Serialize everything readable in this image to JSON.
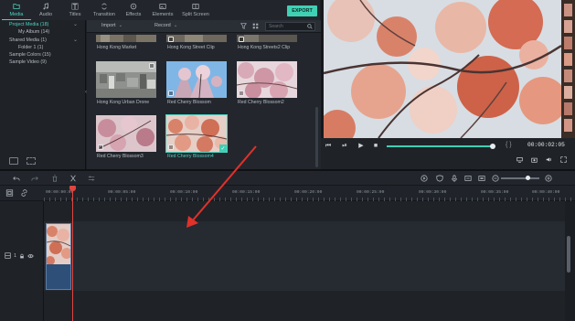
{
  "toolbar": {
    "tabs": [
      {
        "label": "Media",
        "icon": "folder-icon"
      },
      {
        "label": "Audio",
        "icon": "music-note-icon"
      },
      {
        "label": "Titles",
        "icon": "text-icon"
      },
      {
        "label": "Transition",
        "icon": "transition-icon"
      },
      {
        "label": "Effects",
        "icon": "effects-icon"
      },
      {
        "label": "Elements",
        "icon": "elements-icon"
      },
      {
        "label": "Split Screen",
        "icon": "split-screen-icon"
      }
    ],
    "active_tab": "Media",
    "export_label": "EXPORT"
  },
  "library": {
    "items": [
      {
        "label": "Project Media (18)"
      },
      {
        "label": "My Album (14)"
      },
      {
        "label": "Shared Media (1)"
      },
      {
        "label": "Folder 1 (1)"
      },
      {
        "label": "Sample Colors (15)"
      },
      {
        "label": "Sample Video (9)"
      }
    ]
  },
  "media": {
    "import_label": "Import",
    "record_label": "Record",
    "search_placeholder": "Search",
    "items": [
      {
        "label": "Hong Kong Market"
      },
      {
        "label": "Hong Kong Street Clip"
      },
      {
        "label": "Hong Kong Streets2 Clip"
      },
      {
        "label": "Hong Kong Urban Drone"
      },
      {
        "label": "Red Cherry Blossom"
      },
      {
        "label": "Red Cherry Blossom2"
      },
      {
        "label": "Red Cherry Blossom3"
      },
      {
        "label": "Red Cherry Blossom4"
      }
    ],
    "selected_item": "Red Cherry Blossom4"
  },
  "preview": {
    "timecode": "00:00:02:05",
    "progress": 0.98,
    "bracket_label": "{    }"
  },
  "timeline": {
    "ruler_labels": [
      "00:00:00:00",
      "00:00:05:00",
      "00:00:10:00",
      "00:00:15:00",
      "00:00:20:00",
      "00:00:25:00",
      "00:00:30:00",
      "00:00:35:00",
      "00:00:40:00"
    ],
    "track_label": "1",
    "zoom_level": 0.7
  },
  "colors": {
    "accent": "#3fd0b4",
    "playhead": "#e0453f",
    "annotation_arrow": "#e0312b"
  }
}
